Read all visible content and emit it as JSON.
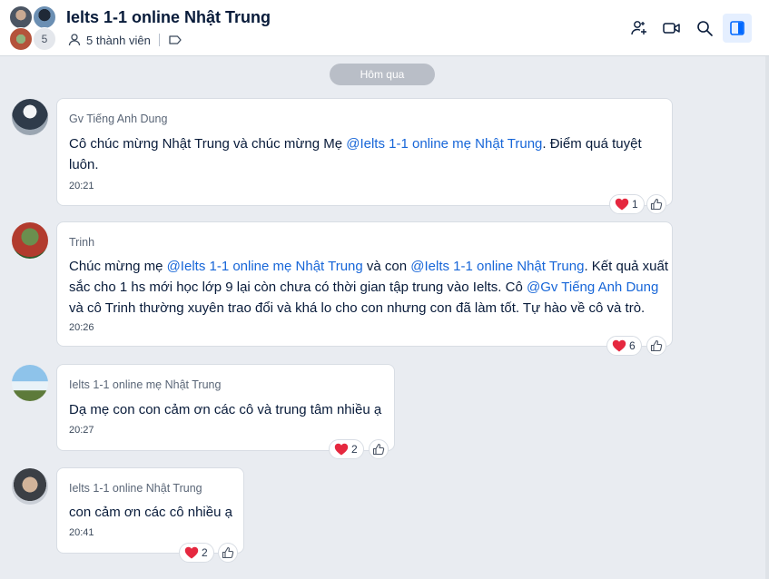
{
  "header": {
    "title": "Ielts 1-1 online Nhật Trung",
    "member_count": "5",
    "members_label": "5 thành viên",
    "icons": [
      "add-member-icon",
      "video-call-icon",
      "search-icon",
      "sidebar-toggle-icon"
    ]
  },
  "date_divider": "Hôm qua",
  "messages": [
    {
      "sender": "Gv Tiếng Anh Dung",
      "lines": [
        [
          {
            "t": "Cô chúc mừng Nhật Trung và chúc mừng Mẹ "
          },
          {
            "t": "@Ielts 1-1 online mẹ Nhật Trung",
            "m": true
          },
          {
            "t": ". Điểm quá tuyệt"
          }
        ],
        [
          {
            "t": "luôn."
          }
        ]
      ],
      "time": "20:21",
      "reaction_count": "1"
    },
    {
      "sender": "Trinh",
      "lines": [
        [
          {
            "t": "Chúc mừng mẹ "
          },
          {
            "t": "@Ielts 1-1 online mẹ Nhật Trung",
            "m": true
          },
          {
            "t": " và con "
          },
          {
            "t": "@Ielts 1-1 online Nhật Trung",
            "m": true
          },
          {
            "t": ". Kết quả xuất"
          }
        ],
        [
          {
            "t": "sắc cho 1 hs mới học lớp 9 lại còn chưa có thời gian tập trung vào Ielts. Cô "
          },
          {
            "t": "@Gv Tiếng Anh Dung",
            "m": true
          }
        ],
        [
          {
            "t": "và cô Trinh thường xuyên trao đổi và khá lo cho con nhưng con đã làm tốt. Tự hào về cô và trò."
          }
        ]
      ],
      "time": "20:26",
      "reaction_count": "6"
    },
    {
      "sender": "Ielts 1-1 online mẹ Nhật Trung",
      "lines": [
        [
          {
            "t": "Dạ mẹ con con cảm ơn các cô và trung tâm nhiều ạ"
          }
        ]
      ],
      "time": "20:27",
      "reaction_count": "2"
    },
    {
      "sender": "Ielts 1-1 online Nhật Trung",
      "lines": [
        [
          {
            "t": "con cảm ơn các cô nhiều ạ"
          }
        ]
      ],
      "time": "20:41",
      "reaction_count": "2"
    }
  ],
  "colors": {
    "background": "#e9ecf1",
    "mention": "#1766d8",
    "heart": "#e5283f",
    "active_button": "#e5efff",
    "accent": "#0068ff"
  }
}
